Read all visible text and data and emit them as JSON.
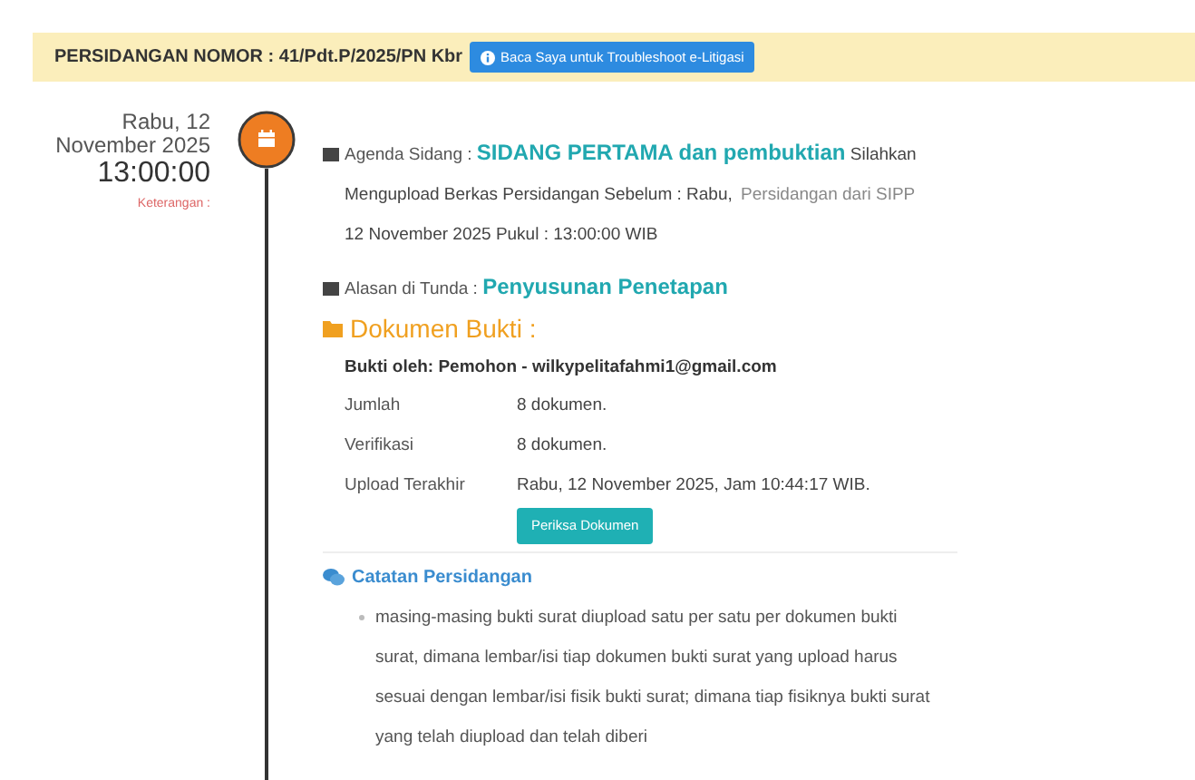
{
  "banner": {
    "title": "PERSIDANGAN NOMOR : 41/Pdt.P/2025/PN Kbr",
    "help_button": "Baca Saya untuk Troubleshoot e-Litigasi"
  },
  "timeline": {
    "date": "Rabu, 12",
    "date_line2": "November 2025",
    "time": "13:00:00",
    "note": "Keterangan :"
  },
  "agenda": {
    "label": "Agenda Sidang :",
    "value": "SIDANG PERTAMA dan pembuktian",
    "text_1": "Silahkan Mengupload Berkas Persidangan Sebelum : Rabu,",
    "source": "Persidangan dari SIPP",
    "text_2": "12 November 2025 Pukul : 13:00:00 WIB"
  },
  "postpone": {
    "label": "Alasan di Tunda :",
    "value": "Penyusunan Penetapan"
  },
  "documents": {
    "title": "Dokumen Bukti :",
    "submitted_by": "Bukti oleh: Pemohon - wilkypelitafahmi1@gmail.com",
    "rows": [
      {
        "label": "Jumlah",
        "value": "8 dokumen."
      },
      {
        "label": "Verifikasi",
        "value": "8 dokumen."
      },
      {
        "label": "Upload Terakhir",
        "value": "Rabu, 12 November 2025, Jam 10:44:17 WIB."
      }
    ],
    "button": "Periksa Dokumen"
  },
  "notes": {
    "title": "Catatan Persidangan",
    "items": [
      "masing-masing bukti surat diupload satu per satu per dokumen bukti surat, dimana lembar/isi tiap dokumen bukti surat yang upload harus sesuai dengan lembar/isi fisik bukti surat; dimana tiap fisiknya bukti surat yang telah diupload dan telah diberi"
    ]
  }
}
